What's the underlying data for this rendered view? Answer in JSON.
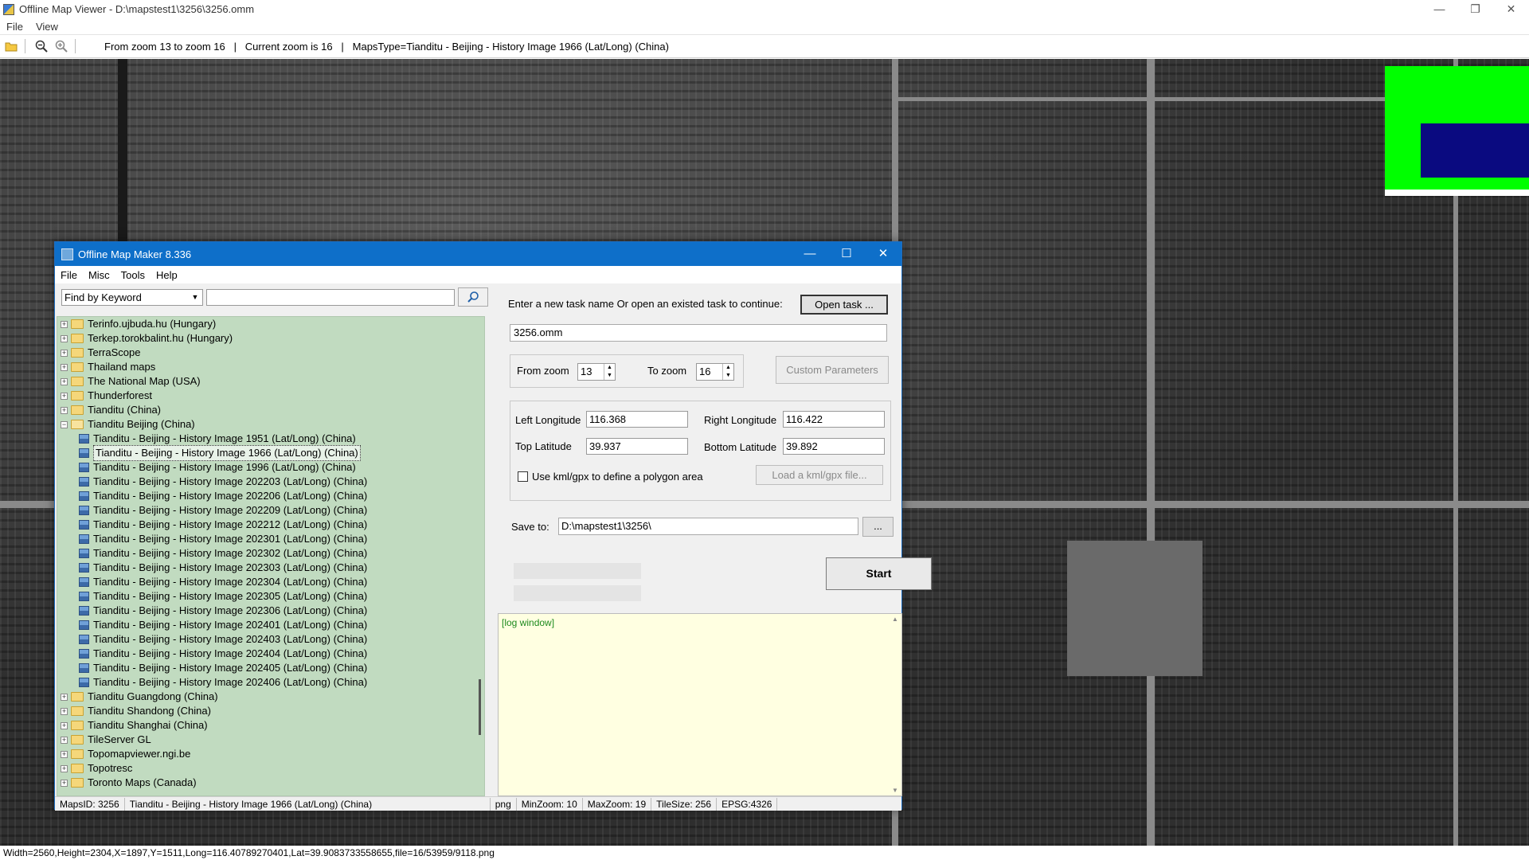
{
  "viewer": {
    "title": "Offline Map Viewer - D:\\mapstest1\\3256\\3256.omm",
    "menu": [
      "File",
      "View"
    ],
    "toolbar_info": "From zoom 13 to zoom 16   |   Current zoom is 16   |   MapsType=Tianditu - Beijing - History Image 1966 (Lat/Long) (China)",
    "status": "Width=2560,Height=2304,X=1897,Y=1511,Long=116.40789270401,Lat=39.9083733558655,file=16/53959/9118.png",
    "minimap_colors": {
      "background": "#00ff00",
      "viewport": "#0a0a80"
    }
  },
  "dialog": {
    "title": "Offline Map Maker 8.336",
    "menu": [
      "File",
      "Misc",
      "Tools",
      "Help"
    ],
    "find": {
      "mode": "Find by Keyword",
      "value": ""
    },
    "tree": [
      {
        "label": "Terinfo.ujbuda.hu (Hungary)",
        "type": "folder"
      },
      {
        "label": "Terkep.torokbalint.hu (Hungary)",
        "type": "folder"
      },
      {
        "label": "TerraScope",
        "type": "folder"
      },
      {
        "label": "Thailand maps",
        "type": "folder"
      },
      {
        "label": "The National Map (USA)",
        "type": "folder"
      },
      {
        "label": "Thunderforest",
        "type": "folder"
      },
      {
        "label": "Tianditu (China)",
        "type": "folder"
      },
      {
        "label": "Tianditu Beijing (China)",
        "type": "folder-open"
      },
      {
        "label": "Tianditu - Beijing - History Image 1951 (Lat/Long) (China)",
        "type": "map"
      },
      {
        "label": "Tianditu - Beijing - History Image 1966 (Lat/Long) (China)",
        "type": "map",
        "selected": true
      },
      {
        "label": "Tianditu - Beijing - History Image 1996 (Lat/Long) (China)",
        "type": "map"
      },
      {
        "label": "Tianditu - Beijing - History Image 202203 (Lat/Long) (China)",
        "type": "map"
      },
      {
        "label": "Tianditu - Beijing - History Image 202206 (Lat/Long) (China)",
        "type": "map"
      },
      {
        "label": "Tianditu - Beijing - History Image 202209 (Lat/Long) (China)",
        "type": "map"
      },
      {
        "label": "Tianditu - Beijing - History Image 202212 (Lat/Long) (China)",
        "type": "map"
      },
      {
        "label": "Tianditu - Beijing - History Image 202301 (Lat/Long) (China)",
        "type": "map"
      },
      {
        "label": "Tianditu - Beijing - History Image 202302 (Lat/Long) (China)",
        "type": "map"
      },
      {
        "label": "Tianditu - Beijing - History Image 202303 (Lat/Long) (China)",
        "type": "map"
      },
      {
        "label": "Tianditu - Beijing - History Image 202304 (Lat/Long) (China)",
        "type": "map"
      },
      {
        "label": "Tianditu - Beijing - History Image 202305 (Lat/Long) (China)",
        "type": "map"
      },
      {
        "label": "Tianditu - Beijing - History Image 202306 (Lat/Long) (China)",
        "type": "map"
      },
      {
        "label": "Tianditu - Beijing - History Image 202401 (Lat/Long) (China)",
        "type": "map"
      },
      {
        "label": "Tianditu - Beijing - History Image 202403 (Lat/Long) (China)",
        "type": "map"
      },
      {
        "label": "Tianditu - Beijing - History Image 202404 (Lat/Long) (China)",
        "type": "map"
      },
      {
        "label": "Tianditu - Beijing - History Image 202405 (Lat/Long) (China)",
        "type": "map"
      },
      {
        "label": "Tianditu - Beijing - History Image 202406 (Lat/Long) (China)",
        "type": "map"
      },
      {
        "label": "Tianditu Guangdong (China)",
        "type": "folder"
      },
      {
        "label": "Tianditu Shandong (China)",
        "type": "folder"
      },
      {
        "label": "Tianditu Shanghai (China)",
        "type": "folder"
      },
      {
        "label": "TileServer GL",
        "type": "folder"
      },
      {
        "label": "Topomapviewer.ngi.be",
        "type": "folder"
      },
      {
        "label": "Topotresc",
        "type": "folder"
      },
      {
        "label": "Toronto Maps (Canada)",
        "type": "folder"
      }
    ],
    "task_prompt": "Enter a new task name Or open an existed task to continue:",
    "open_task_label": "Open task ...",
    "task_name": "3256.omm",
    "from_zoom_label": "From zoom",
    "from_zoom": "13",
    "to_zoom_label": "To zoom",
    "to_zoom": "16",
    "custom_params_label": "Custom Parameters",
    "left_lon_label": "Left Longitude",
    "left_lon": "116.368",
    "right_lon_label": "Right Longitude",
    "right_lon": "116.422",
    "top_lat_label": "Top Latitude",
    "top_lat": "39.937",
    "bottom_lat_label": "Bottom Latitude",
    "bottom_lat": "39.892",
    "kml_label": "Use kml/gpx to define a polygon area",
    "load_kml_label": "Load a kml/gpx file...",
    "save_label": "Save to:",
    "save_path": "D:\\mapstest1\\3256\\",
    "browse_label": "...",
    "start_label": "Start",
    "log_text": "[log window]",
    "status": {
      "maps_id": "MapsID:  3256",
      "map_name": "Tianditu - Beijing - History Image 1966 (Lat/Long) (China)",
      "format": "png",
      "min_zoom": "MinZoom: 10",
      "max_zoom": "MaxZoom: 19",
      "tile_size": "TileSize: 256",
      "epsg": "EPSG:4326"
    }
  }
}
